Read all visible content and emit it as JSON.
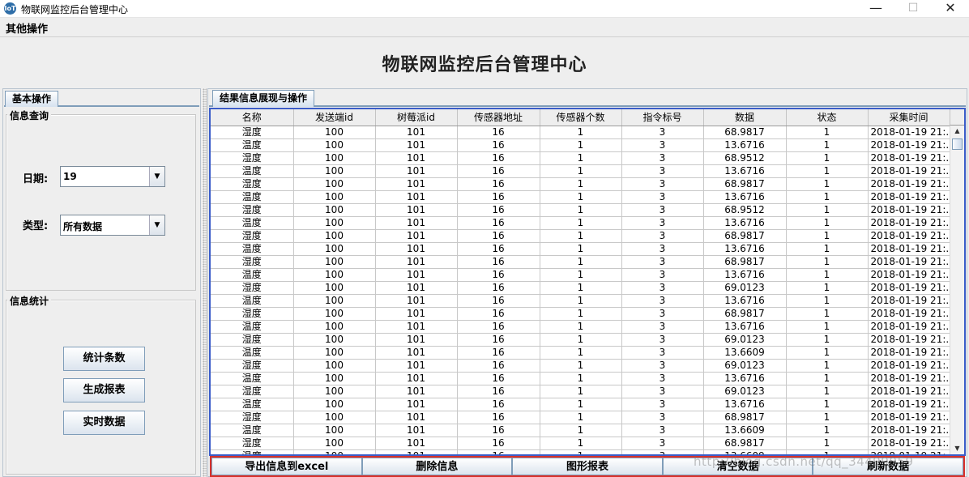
{
  "window": {
    "title": "物联网监控后台管理中心",
    "icon": "app-logo-icon",
    "controls": {
      "minimize": "—",
      "maximize": "☐",
      "close": "✕"
    }
  },
  "menubar": {
    "items": [
      {
        "label": "其他操作"
      }
    ]
  },
  "header": {
    "title": "物联网监控后台管理中心"
  },
  "left_panel": {
    "tab_label": "基本操作",
    "query_group": {
      "title": "信息查询",
      "date_label": "日期:",
      "date_value": "19",
      "type_label": "类型:",
      "type_value": "所有数据"
    },
    "stats_group": {
      "title": "信息统计",
      "buttons": [
        {
          "label": "统计条数"
        },
        {
          "label": "生成报表"
        },
        {
          "label": "实时数据"
        }
      ]
    }
  },
  "right_panel": {
    "tab_label": "结果信息展现与操作",
    "table": {
      "columns": [
        "名称",
        "发送端id",
        "树莓派id",
        "传感器地址",
        "传感器个数",
        "指令标号",
        "数据",
        "状态",
        "采集时间"
      ],
      "rows": [
        [
          "湿度",
          "100",
          "101",
          "16",
          "1",
          "3",
          "68.9817",
          "1",
          "2018-01-19 21:..."
        ],
        [
          "温度",
          "100",
          "101",
          "16",
          "1",
          "3",
          "13.6716",
          "1",
          "2018-01-19 21:..."
        ],
        [
          "湿度",
          "100",
          "101",
          "16",
          "1",
          "3",
          "68.9512",
          "1",
          "2018-01-19 21:..."
        ],
        [
          "温度",
          "100",
          "101",
          "16",
          "1",
          "3",
          "13.6716",
          "1",
          "2018-01-19 21:..."
        ],
        [
          "湿度",
          "100",
          "101",
          "16",
          "1",
          "3",
          "68.9817",
          "1",
          "2018-01-19 21:..."
        ],
        [
          "温度",
          "100",
          "101",
          "16",
          "1",
          "3",
          "13.6716",
          "1",
          "2018-01-19 21:..."
        ],
        [
          "湿度",
          "100",
          "101",
          "16",
          "1",
          "3",
          "68.9512",
          "1",
          "2018-01-19 21:..."
        ],
        [
          "温度",
          "100",
          "101",
          "16",
          "1",
          "3",
          "13.6716",
          "1",
          "2018-01-19 21:..."
        ],
        [
          "湿度",
          "100",
          "101",
          "16",
          "1",
          "3",
          "68.9817",
          "1",
          "2018-01-19 21:..."
        ],
        [
          "温度",
          "100",
          "101",
          "16",
          "1",
          "3",
          "13.6716",
          "1",
          "2018-01-19 21:..."
        ],
        [
          "湿度",
          "100",
          "101",
          "16",
          "1",
          "3",
          "68.9817",
          "1",
          "2018-01-19 21:..."
        ],
        [
          "温度",
          "100",
          "101",
          "16",
          "1",
          "3",
          "13.6716",
          "1",
          "2018-01-19 21:..."
        ],
        [
          "湿度",
          "100",
          "101",
          "16",
          "1",
          "3",
          "69.0123",
          "1",
          "2018-01-19 21:..."
        ],
        [
          "温度",
          "100",
          "101",
          "16",
          "1",
          "3",
          "13.6716",
          "1",
          "2018-01-19 21:..."
        ],
        [
          "湿度",
          "100",
          "101",
          "16",
          "1",
          "3",
          "68.9817",
          "1",
          "2018-01-19 21:..."
        ],
        [
          "温度",
          "100",
          "101",
          "16",
          "1",
          "3",
          "13.6716",
          "1",
          "2018-01-19 21:..."
        ],
        [
          "湿度",
          "100",
          "101",
          "16",
          "1",
          "3",
          "69.0123",
          "1",
          "2018-01-19 21:..."
        ],
        [
          "温度",
          "100",
          "101",
          "16",
          "1",
          "3",
          "13.6609",
          "1",
          "2018-01-19 21:..."
        ],
        [
          "湿度",
          "100",
          "101",
          "16",
          "1",
          "3",
          "69.0123",
          "1",
          "2018-01-19 21:..."
        ],
        [
          "温度",
          "100",
          "101",
          "16",
          "1",
          "3",
          "13.6716",
          "1",
          "2018-01-19 21:..."
        ],
        [
          "湿度",
          "100",
          "101",
          "16",
          "1",
          "3",
          "69.0123",
          "1",
          "2018-01-19 21:..."
        ],
        [
          "温度",
          "100",
          "101",
          "16",
          "1",
          "3",
          "13.6716",
          "1",
          "2018-01-19 21:..."
        ],
        [
          "湿度",
          "100",
          "101",
          "16",
          "1",
          "3",
          "68.9817",
          "1",
          "2018-01-19 21:..."
        ],
        [
          "温度",
          "100",
          "101",
          "16",
          "1",
          "3",
          "13.6609",
          "1",
          "2018-01-19 21:..."
        ],
        [
          "湿度",
          "100",
          "101",
          "16",
          "1",
          "3",
          "68.9817",
          "1",
          "2018-01-19 21:..."
        ],
        [
          "温度",
          "100",
          "101",
          "16",
          "1",
          "3",
          "13.6609",
          "1",
          "2018-01-19 21:..."
        ]
      ]
    },
    "actions": [
      {
        "label": "导出信息到excel"
      },
      {
        "label": "删除信息"
      },
      {
        "label": "图形报表"
      },
      {
        "label": "清空数据"
      },
      {
        "label": "刷新数据"
      }
    ]
  },
  "watermark": "http://blog.csdn.net/qq_34499059",
  "colors": {
    "table_border": "#3a5cc9",
    "action_border": "#d9302a",
    "tab_gradient_end": "#d6e2ef"
  }
}
